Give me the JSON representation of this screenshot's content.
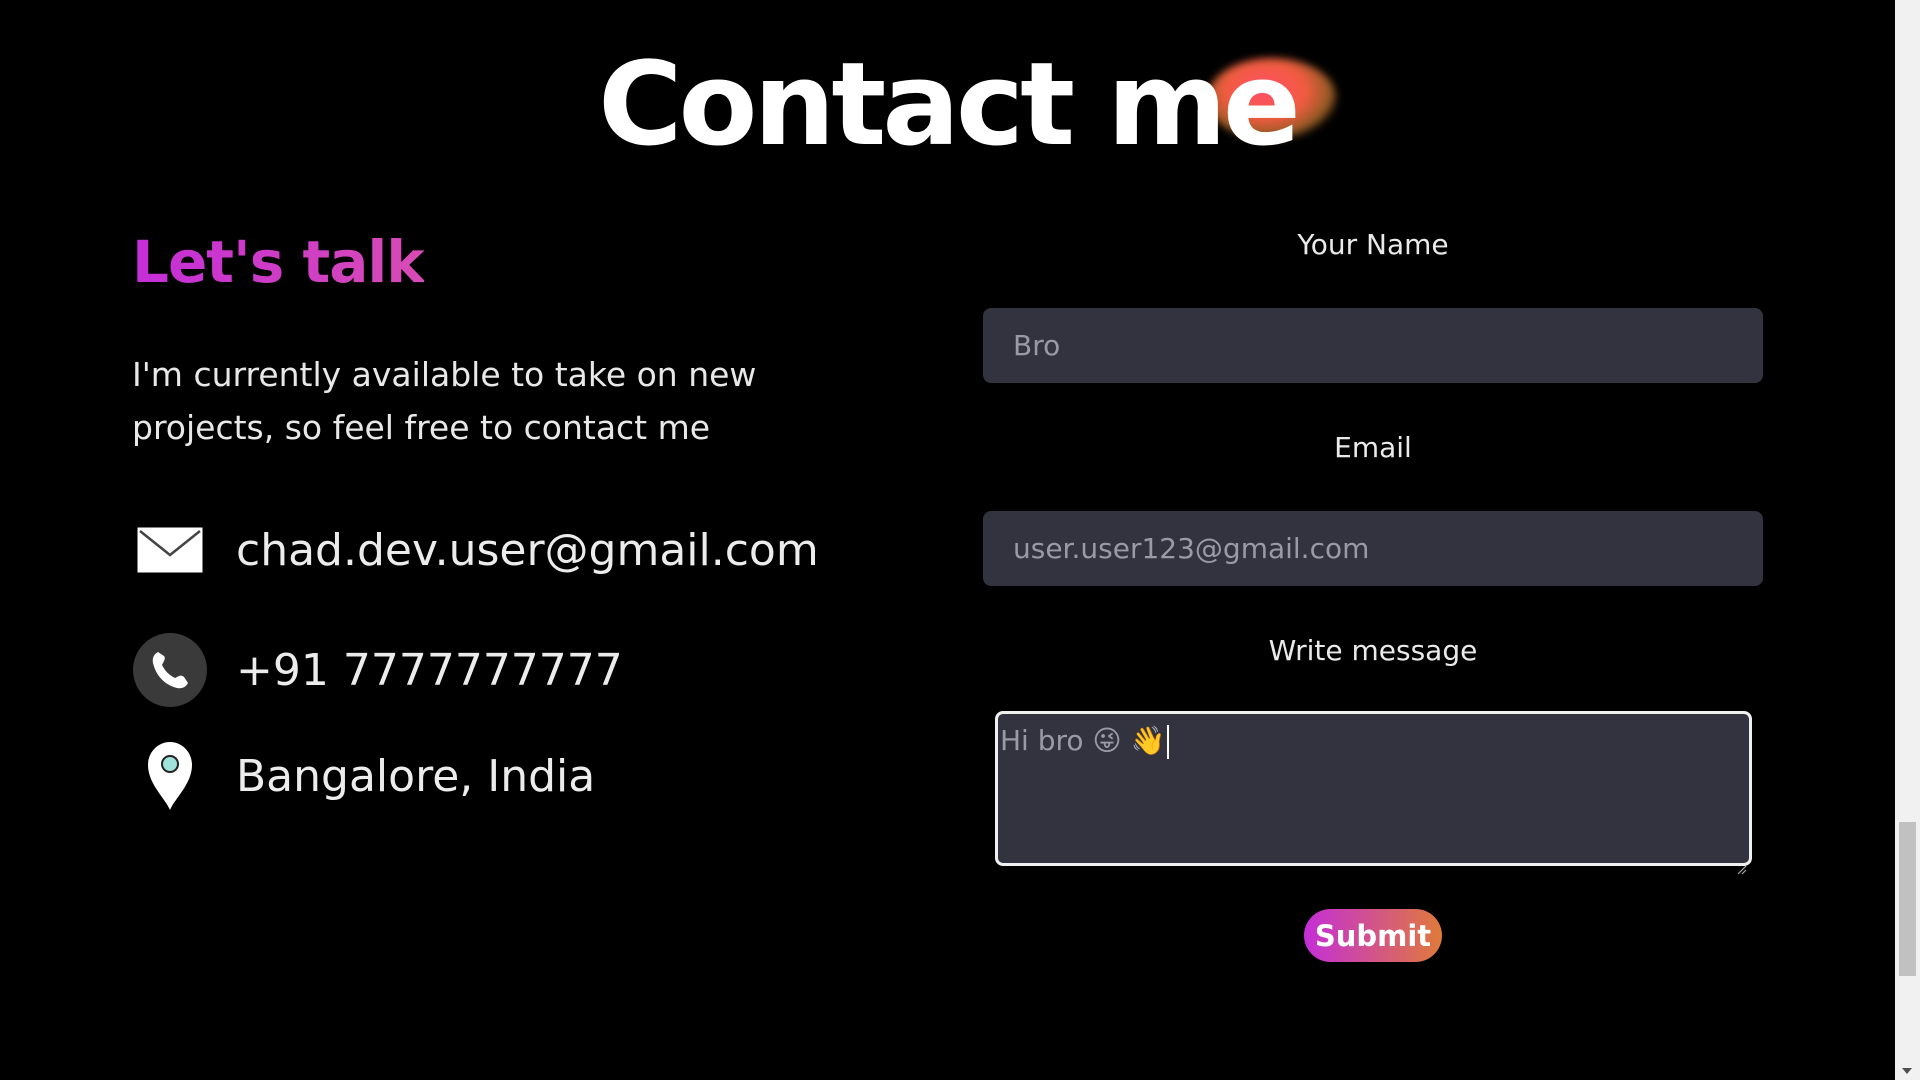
{
  "header": {
    "title": "Contact me"
  },
  "left": {
    "heading": "Let's talk",
    "intro": "I'm currently available to take on new projects, so feel free to contact me",
    "email": "chad.dev.user@gmail.com",
    "phone": "+91 7777777777",
    "location": "Bangalore, India",
    "icons": {
      "email": "envelope-icon",
      "phone": "phone-icon",
      "location": "map-pin-icon"
    }
  },
  "form": {
    "name_label": "Your Name",
    "name_value": "Bro",
    "email_label": "Email",
    "email_value": "user.user123@gmail.com",
    "message_label": "Write message",
    "message_value": "Hi bro 😜 👋",
    "submit_label": "Submit"
  },
  "colors": {
    "background": "#000000",
    "input_bg": "#33333f",
    "accent_start": "#c42ed8",
    "accent_end": "#e07a3a"
  }
}
